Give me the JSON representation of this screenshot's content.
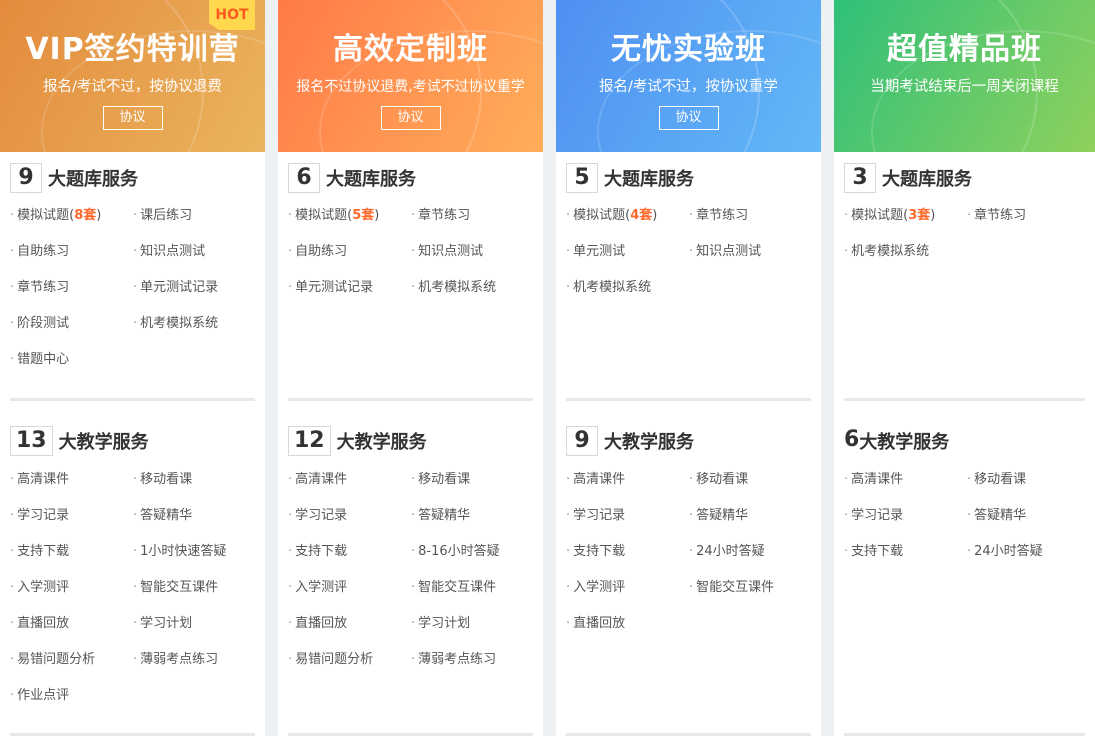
{
  "cards": [
    {
      "title": "VIP签约特训营",
      "subtitle": "报名/考试不过，按协议退费",
      "button": "协议",
      "badge": "HOT",
      "bank_count": "9",
      "bank_label": "大题库服务",
      "bank_items": [
        {
          "text": "模拟试题(",
          "hl": "8套",
          "tail": ")"
        },
        {
          "text": "课后练习"
        },
        {
          "text": "自助练习"
        },
        {
          "text": "知识点测试"
        },
        {
          "text": "章节练习"
        },
        {
          "text": "单元测试记录"
        },
        {
          "text": "阶段测试"
        },
        {
          "text": "机考模拟系统"
        },
        {
          "text": "错题中心"
        }
      ],
      "teach_count": "13",
      "teach_label": "大教学服务",
      "teach_items": [
        "高清课件",
        "移动看课",
        "学习记录",
        "答疑精华",
        "支持下载",
        "1小时快速答疑",
        "入学测评",
        "智能交互课件",
        "直播回放",
        "学习计划",
        "易错问题分析",
        "薄弱考点练习",
        "作业点评"
      ]
    },
    {
      "title": "高效定制班",
      "subtitle": "报名不过协议退费,考试不过协议重学",
      "button": "协议",
      "bank_count": "6",
      "bank_label": "大题库服务",
      "bank_items": [
        {
          "text": "模拟试题(",
          "hl": "5套",
          "tail": ")"
        },
        {
          "text": "章节练习"
        },
        {
          "text": "自助练习"
        },
        {
          "text": "知识点测试"
        },
        {
          "text": "单元测试记录"
        },
        {
          "text": "机考模拟系统"
        }
      ],
      "teach_count": "12",
      "teach_label": "大教学服务",
      "teach_items": [
        "高清课件",
        "移动看课",
        "学习记录",
        "答疑精华",
        "支持下载",
        "8-16小时答疑",
        "入学测评",
        "智能交互课件",
        "直播回放",
        "学习计划",
        "易错问题分析",
        "薄弱考点练习"
      ]
    },
    {
      "title": "无忧实验班",
      "subtitle": "报名/考试不过，按协议重学",
      "button": "协议",
      "bank_count": "5",
      "bank_label": "大题库服务",
      "bank_items": [
        {
          "text": "模拟试题(",
          "hl": "4套",
          "tail": ")"
        },
        {
          "text": "章节练习"
        },
        {
          "text": "单元测试"
        },
        {
          "text": "知识点测试"
        },
        {
          "text": "机考模拟系统"
        }
      ],
      "teach_count": "9",
      "teach_label": "大教学服务",
      "teach_items": [
        "高清课件",
        "移动看课",
        "学习记录",
        "答疑精华",
        "支持下载",
        "24小时答疑",
        "入学测评",
        "智能交互课件",
        "直播回放"
      ]
    },
    {
      "title": "超值精品班",
      "subtitle": "当期考试结束后一周关闭课程",
      "bank_count": "3",
      "bank_label": "大题库服务",
      "bank_items": [
        {
          "text": "模拟试题(",
          "hl": "3套",
          "tail": ")"
        },
        {
          "text": "章节练习"
        },
        {
          "text": "机考模拟系统"
        }
      ],
      "teach_count": "6",
      "teach_label": "大教学服务",
      "teach_items": [
        "高清课件",
        "移动看课",
        "学习记录",
        "答疑精华",
        "支持下载",
        "24小时答疑"
      ]
    }
  ],
  "colors": {
    "card1": [
      "#e38b3c",
      "#ebb45e"
    ],
    "card2": [
      "#ff7a48",
      "#ffae5a"
    ],
    "card3": [
      "#4f8ff2",
      "#63b8f6"
    ],
    "card4": [
      "#2fc07a",
      "#8fd15c"
    ],
    "highlight": "#ff6a2c"
  }
}
